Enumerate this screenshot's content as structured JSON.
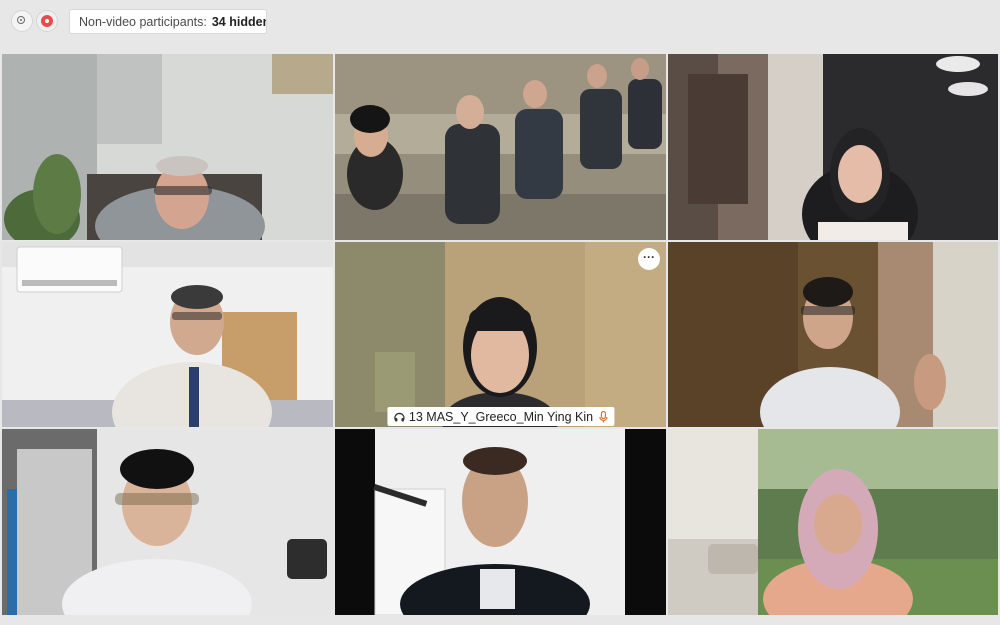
{
  "toolbar": {
    "participants_label": "Non-video participants:",
    "participants_count": "34 hidden"
  },
  "tiles": [
    {
      "id": "p1"
    },
    {
      "id": "p2"
    },
    {
      "id": "p3"
    },
    {
      "id": "p4"
    },
    {
      "id": "p5",
      "name": "13 MAS_Y_Greeco_Min Ying Kin",
      "active": true
    },
    {
      "id": "p6"
    },
    {
      "id": "p7"
    },
    {
      "id": "p8"
    },
    {
      "id": "p9"
    }
  ],
  "colors": {
    "active_highlight": "#4f9aff",
    "mic_accent": "#e0752f"
  }
}
